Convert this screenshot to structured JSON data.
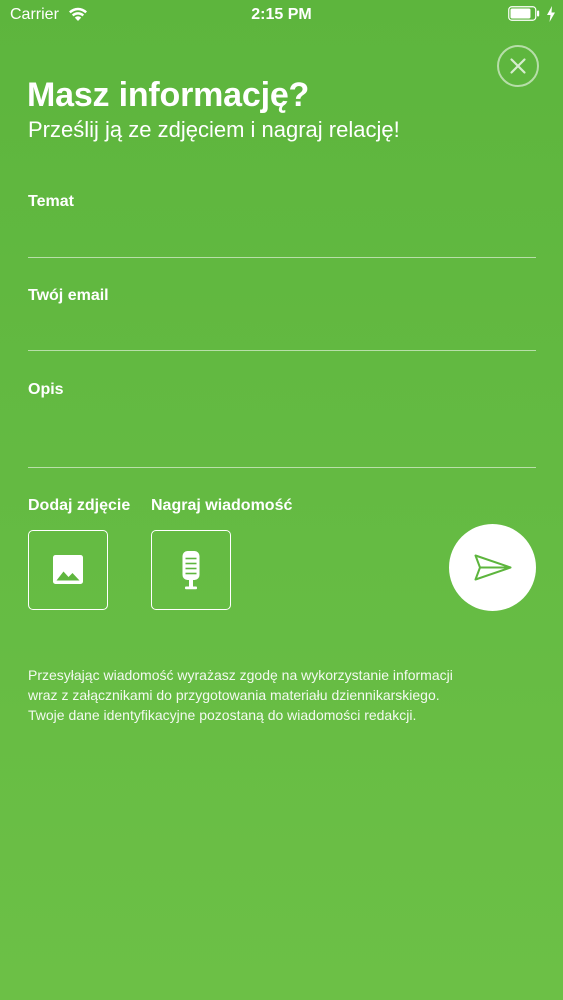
{
  "status_bar": {
    "carrier": "Carrier",
    "time": "2:15 PM",
    "battery_level": 0.85
  },
  "header": {
    "title": "Masz informację?",
    "subtitle": "Prześlij ją ze zdjęciem i nagraj relację!"
  },
  "form": {
    "topic": {
      "label": "Temat",
      "value": ""
    },
    "email": {
      "label": "Twój email",
      "value": ""
    },
    "description": {
      "label": "Opis",
      "value": ""
    }
  },
  "attachments": {
    "photo_label": "Dodaj zdjęcie",
    "audio_label": "Nagraj wiadomość"
  },
  "disclaimer": {
    "lines": [
      "Przesyłając wiadomość wyrażasz zgodę na wykorzystanie informacji",
      "wraz z załącznikami do przygotowania materiału dziennikarskiego.",
      "Twoje dane identyfikacyjne pozostaną do wiadomości redakcji."
    ]
  },
  "colors": {
    "background": "#63b942",
    "accent": "#5db53d",
    "foreground": "#ffffff"
  },
  "icons": {
    "close": "close-icon",
    "photo": "image-icon",
    "audio": "microphone-icon",
    "send": "paper-plane-icon"
  }
}
